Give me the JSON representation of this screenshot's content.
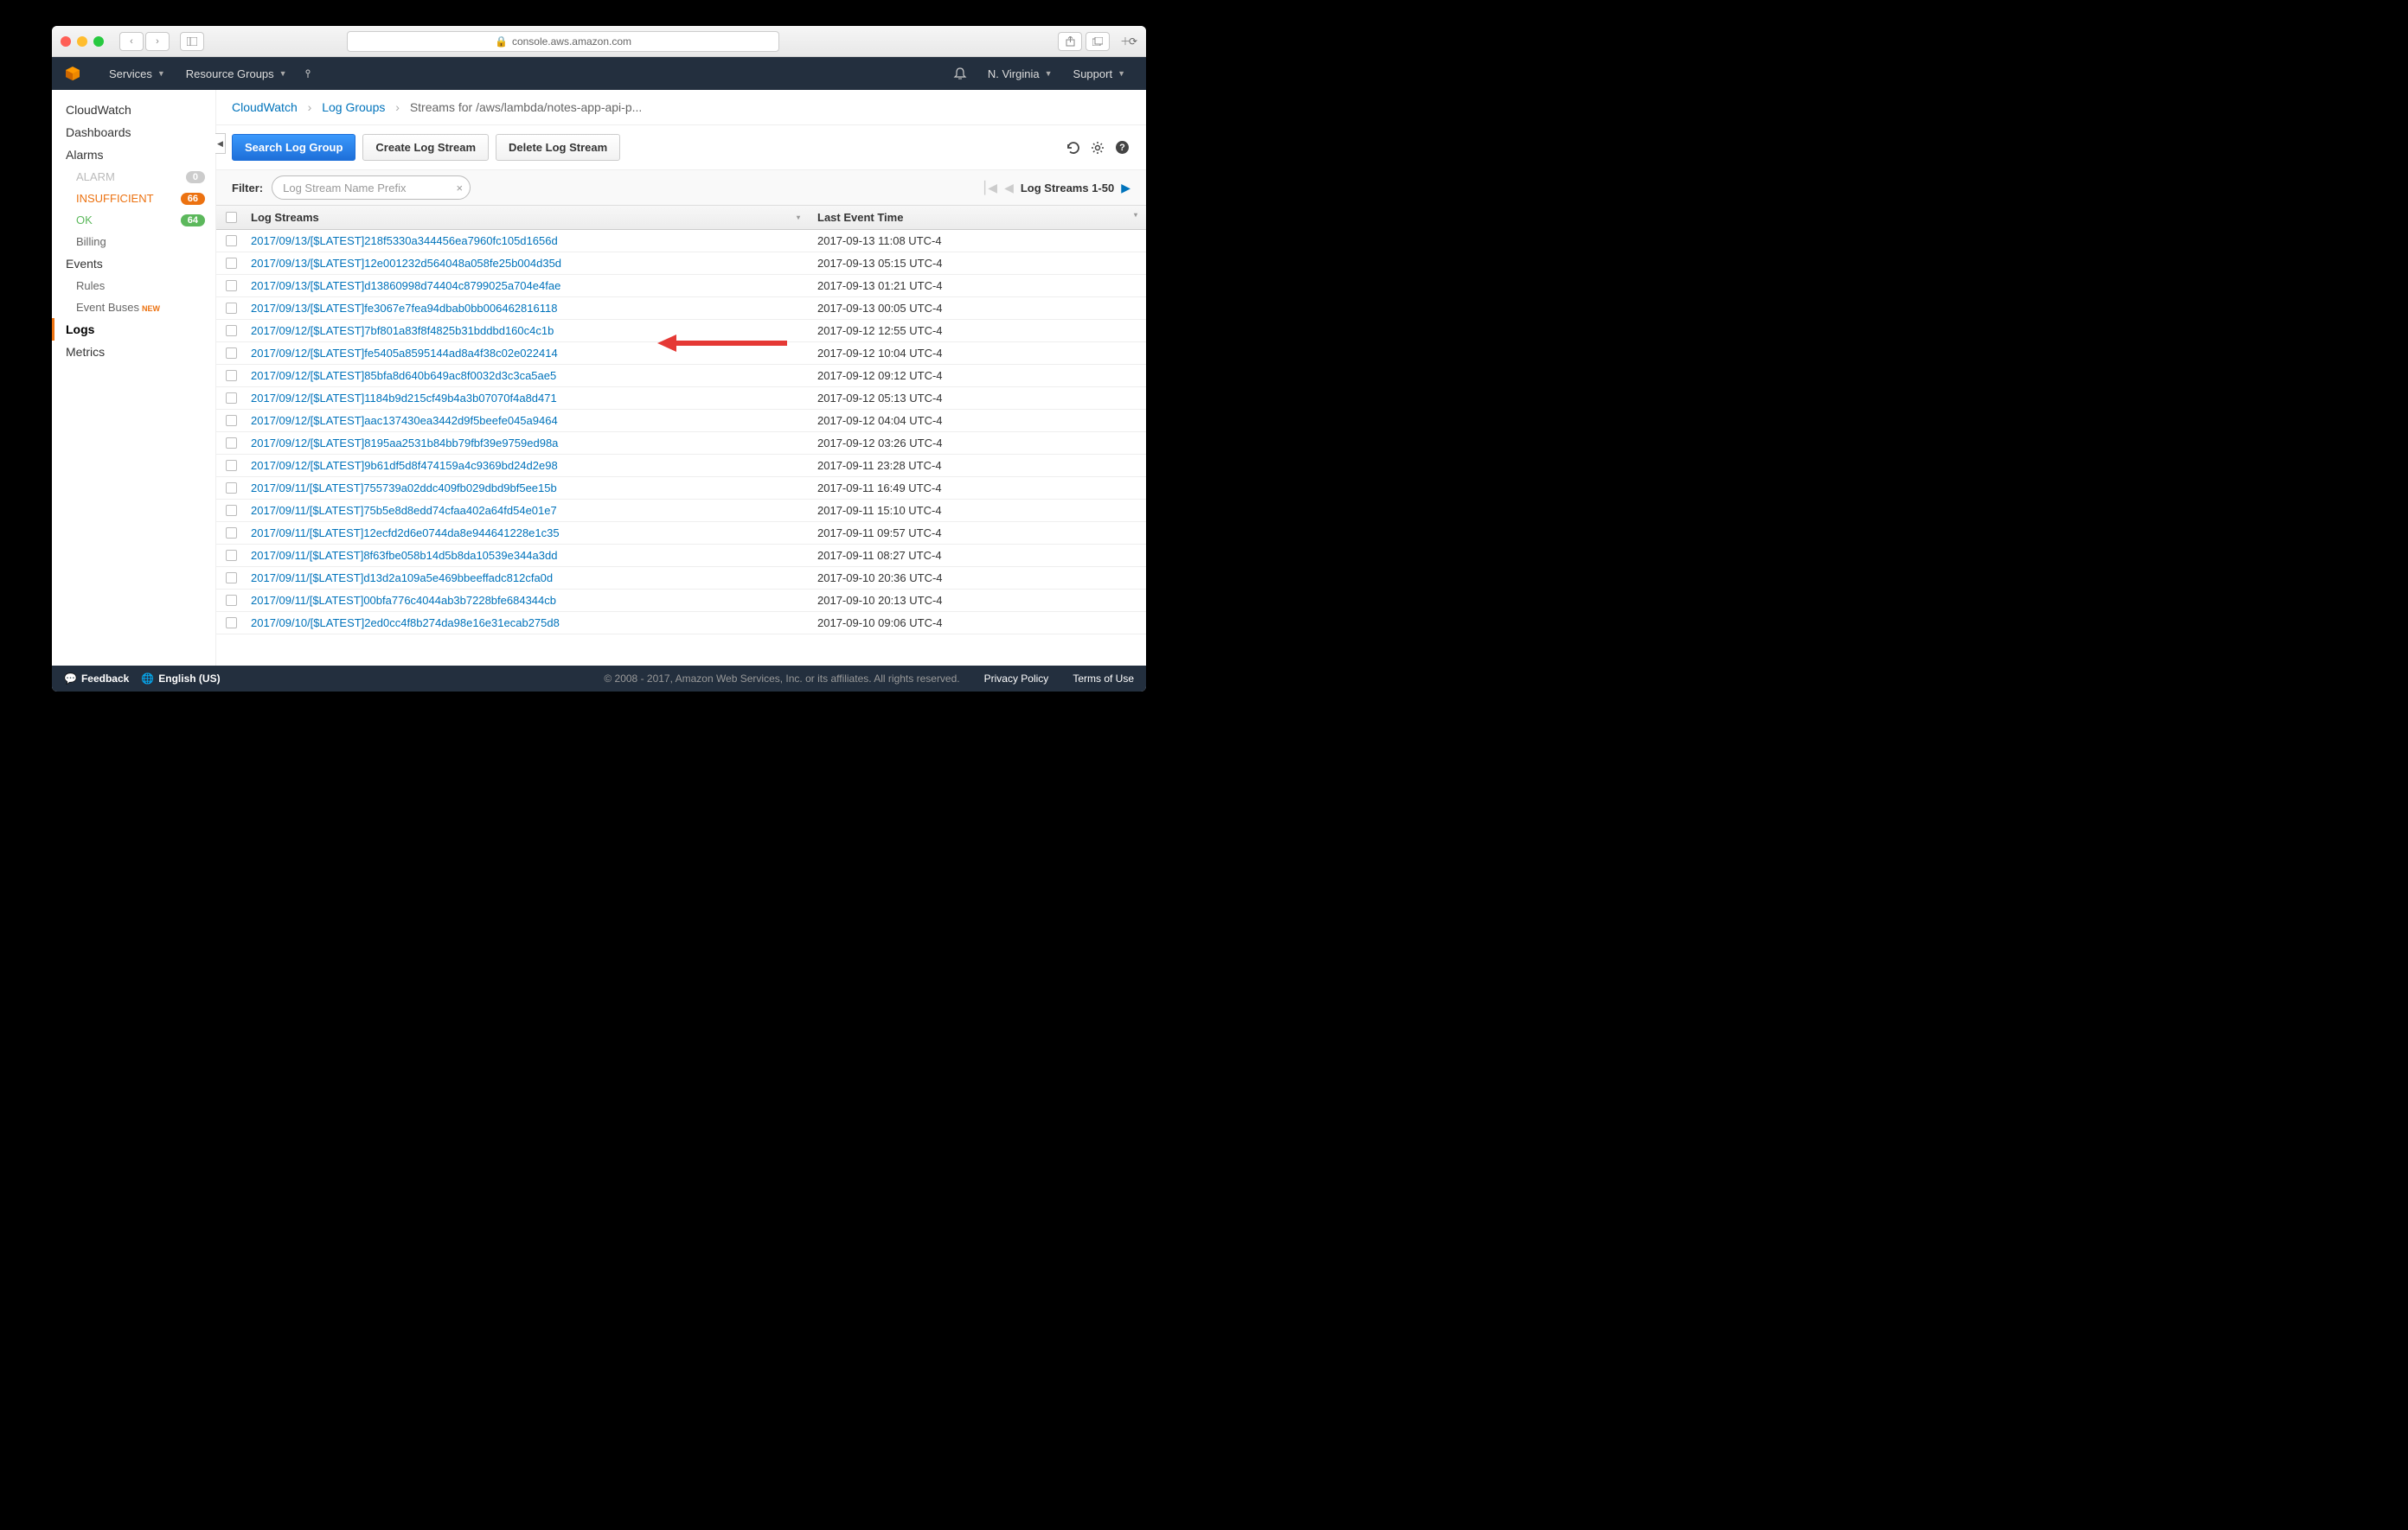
{
  "browser": {
    "url": "console.aws.amazon.com"
  },
  "header": {
    "services": "Services",
    "resource_groups": "Resource Groups",
    "region": "N. Virginia",
    "support": "Support"
  },
  "sidebar": {
    "items": [
      {
        "label": "CloudWatch"
      },
      {
        "label": "Dashboards"
      },
      {
        "label": "Alarms"
      },
      {
        "label": "ALARM",
        "badge": "0",
        "badge_class": "gray"
      },
      {
        "label": "INSUFFICIENT",
        "badge": "66",
        "badge_class": "orange",
        "color": "#ec7211"
      },
      {
        "label": "OK",
        "badge": "64",
        "badge_class": "green",
        "color": "#5cb85c"
      },
      {
        "label": "Billing"
      },
      {
        "label": "Events"
      },
      {
        "label": "Rules"
      },
      {
        "label": "Event Buses",
        "new": "NEW"
      },
      {
        "label": "Logs"
      },
      {
        "label": "Metrics"
      }
    ]
  },
  "breadcrumbs": {
    "cloudwatch": "CloudWatch",
    "log_groups": "Log Groups",
    "current": "Streams for /aws/lambda/notes-app-api-p..."
  },
  "actions": {
    "search": "Search Log Group",
    "create": "Create Log Stream",
    "delete": "Delete Log Stream"
  },
  "filter": {
    "label": "Filter:",
    "placeholder": "Log Stream Name Prefix",
    "page_text": "Log Streams 1-50"
  },
  "table": {
    "col_name": "Log Streams",
    "col_time": "Last Event Time",
    "rows": [
      {
        "name": "2017/09/13/[$LATEST]218f5330a344456ea7960fc105d1656d",
        "time": "2017-09-13 11:08 UTC-4"
      },
      {
        "name": "2017/09/13/[$LATEST]12e001232d564048a058fe25b004d35d",
        "time": "2017-09-13 05:15 UTC-4"
      },
      {
        "name": "2017/09/13/[$LATEST]d13860998d74404c8799025a704e4fae",
        "time": "2017-09-13 01:21 UTC-4"
      },
      {
        "name": "2017/09/13/[$LATEST]fe3067e7fea94dbab0bb006462816118",
        "time": "2017-09-13 00:05 UTC-4"
      },
      {
        "name": "2017/09/12/[$LATEST]7bf801a83f8f4825b31bddbd160c4c1b",
        "time": "2017-09-12 12:55 UTC-4"
      },
      {
        "name": "2017/09/12/[$LATEST]fe5405a8595144ad8a4f38c02e022414",
        "time": "2017-09-12 10:04 UTC-4"
      },
      {
        "name": "2017/09/12/[$LATEST]85bfa8d640b649ac8f0032d3c3ca5ae5",
        "time": "2017-09-12 09:12 UTC-4"
      },
      {
        "name": "2017/09/12/[$LATEST]1184b9d215cf49b4a3b07070f4a8d471",
        "time": "2017-09-12 05:13 UTC-4"
      },
      {
        "name": "2017/09/12/[$LATEST]aac137430ea3442d9f5beefe045a9464",
        "time": "2017-09-12 04:04 UTC-4"
      },
      {
        "name": "2017/09/12/[$LATEST]8195aa2531b84bb79fbf39e9759ed98a",
        "time": "2017-09-12 03:26 UTC-4"
      },
      {
        "name": "2017/09/12/[$LATEST]9b61df5d8f474159a4c9369bd24d2e98",
        "time": "2017-09-11 23:28 UTC-4"
      },
      {
        "name": "2017/09/11/[$LATEST]755739a02ddc409fb029dbd9bf5ee15b",
        "time": "2017-09-11 16:49 UTC-4"
      },
      {
        "name": "2017/09/11/[$LATEST]75b5e8d8edd74cfaa402a64fd54e01e7",
        "time": "2017-09-11 15:10 UTC-4"
      },
      {
        "name": "2017/09/11/[$LATEST]12ecfd2d6e0744da8e944641228e1c35",
        "time": "2017-09-11 09:57 UTC-4"
      },
      {
        "name": "2017/09/11/[$LATEST]8f63fbe058b14d5b8da10539e344a3dd",
        "time": "2017-09-11 08:27 UTC-4"
      },
      {
        "name": "2017/09/11/[$LATEST]d13d2a109a5e469bbeeffadc812cfa0d",
        "time": "2017-09-10 20:36 UTC-4"
      },
      {
        "name": "2017/09/11/[$LATEST]00bfa776c4044ab3b7228bfe684344cb",
        "time": "2017-09-10 20:13 UTC-4"
      },
      {
        "name": "2017/09/10/[$LATEST]2ed0cc4f8b274da98e16e31ecab275d8",
        "time": "2017-09-10 09:06 UTC-4"
      }
    ]
  },
  "footer": {
    "feedback": "Feedback",
    "language": "English (US)",
    "copyright": "© 2008 - 2017, Amazon Web Services, Inc. or its affiliates. All rights reserved.",
    "privacy": "Privacy Policy",
    "terms": "Terms of Use"
  }
}
